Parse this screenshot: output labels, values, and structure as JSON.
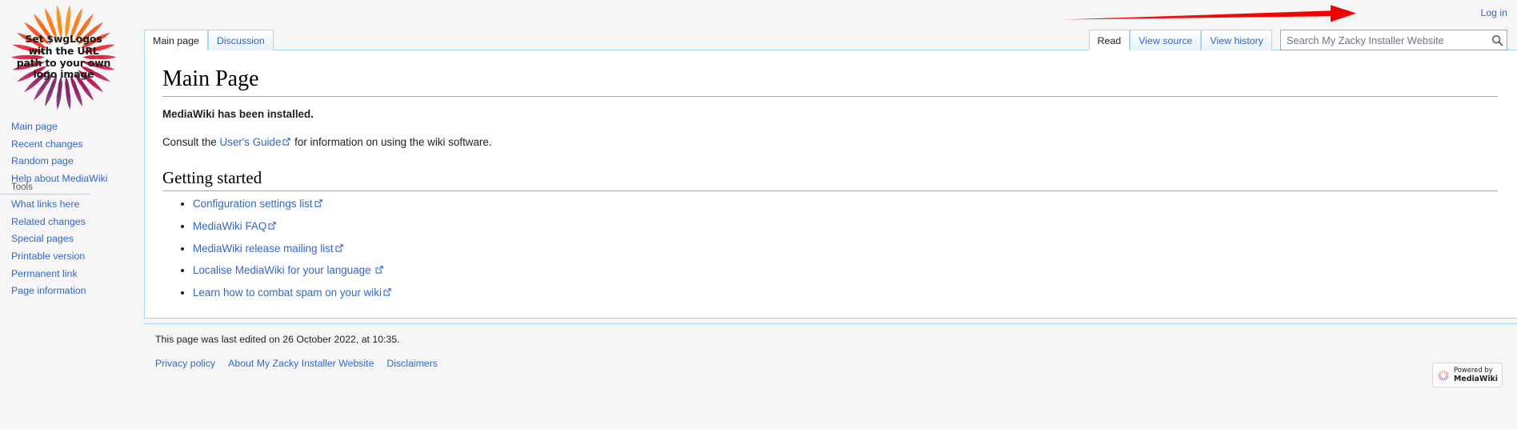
{
  "site": {
    "name": "My Zacky Installer Website",
    "logo_text": "Set $wgLogos with the URL path to your own logo image"
  },
  "personal": {
    "login_label": "Log in"
  },
  "annotation": {
    "arrow_color": "#ee0000",
    "arrow_name": "red-arrow-pointing-to-log-in"
  },
  "tabs": {
    "namespaces": [
      {
        "label": "Main page",
        "selected": true
      },
      {
        "label": "Discussion",
        "selected": false
      }
    ],
    "views": [
      {
        "label": "Read",
        "selected": true
      },
      {
        "label": "View source",
        "selected": false
      },
      {
        "label": "View history",
        "selected": false
      }
    ]
  },
  "search": {
    "placeholder": "Search My Zacky Installer Website",
    "value": "",
    "icon": "search-icon"
  },
  "sidebar": {
    "navigation": {
      "heading": "",
      "items": [
        {
          "label": "Main page"
        },
        {
          "label": "Recent changes"
        },
        {
          "label": "Random page"
        },
        {
          "label": "Help about MediaWiki"
        }
      ]
    },
    "tools": {
      "heading": "Tools",
      "items": [
        {
          "label": "What links here"
        },
        {
          "label": "Related changes"
        },
        {
          "label": "Special pages"
        },
        {
          "label": "Printable version"
        },
        {
          "label": "Permanent link"
        },
        {
          "label": "Page information"
        }
      ]
    }
  },
  "main": {
    "title": "Main Page",
    "installed_line": "MediaWiki has been installed.",
    "consult_prefix": "Consult the ",
    "consult_link": "User's Guide",
    "consult_suffix": " for information on using the wiki software.",
    "getting_started_heading": "Getting started",
    "getting_started_links": [
      {
        "label": "Configuration settings list"
      },
      {
        "label": "MediaWiki FAQ"
      },
      {
        "label": "MediaWiki release mailing list"
      },
      {
        "label": "Localise MediaWiki for your language"
      },
      {
        "label": "Learn how to combat spam on your wiki"
      }
    ]
  },
  "footer": {
    "last_edited": "This page was last edited on 26 October 2022, at 10:35.",
    "places": [
      {
        "label": "Privacy policy"
      },
      {
        "label": "About My Zacky Installer Website"
      },
      {
        "label": "Disclaimers"
      }
    ],
    "badge": {
      "line1": "Powered by",
      "line2": "MediaWiki"
    }
  },
  "colors": {
    "link": "#3366cc",
    "tab_border": "#a7d7f9",
    "page_bg": "#f6f6f6",
    "content_bg": "#ffffff"
  }
}
